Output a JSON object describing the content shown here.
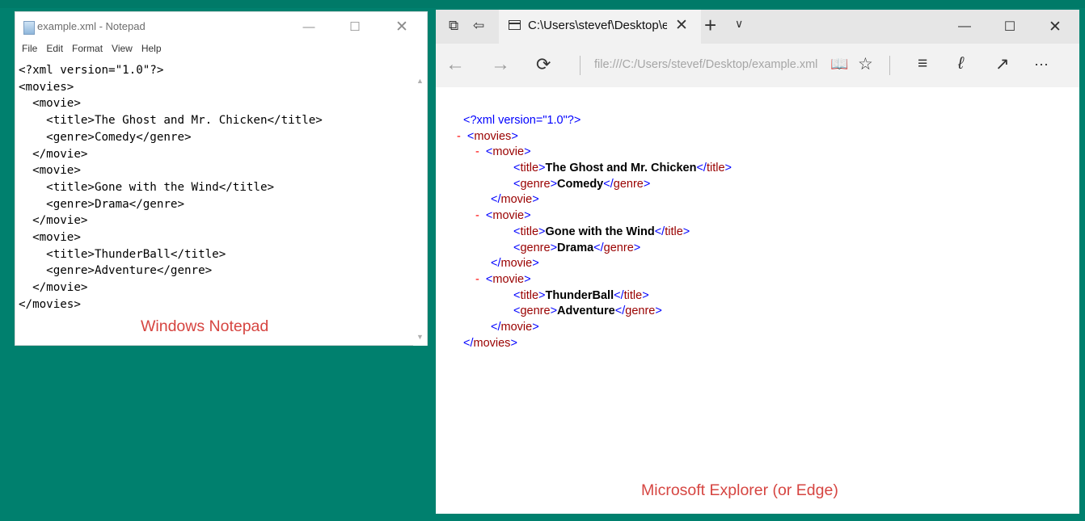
{
  "notepad": {
    "title": "example.xml - Notepad",
    "menu": [
      "File",
      "Edit",
      "Format",
      "View",
      "Help"
    ],
    "content": "<?xml version=\"1.0\"?>\n<movies>\n  <movie>\n    <title>The Ghost and Mr. Chicken</title>\n    <genre>Comedy</genre>\n  </movie>\n  <movie>\n    <title>Gone with the Wind</title>\n    <genre>Drama</genre>\n  </movie>\n  <movie>\n    <title>ThunderBall</title>\n    <genre>Adventure</genre>\n  </movie>\n</movies>",
    "caption": "Windows Notepad"
  },
  "edge": {
    "tab_title": "C:\\Users\\stevef\\Desktop\\example.xml",
    "address": "file:///C:/Users/stevef/Desktop/example.xml",
    "caption": "Microsoft Explorer (or Edge)",
    "xml": {
      "declaration": "<?xml version=\"1.0\"?>",
      "collapse_marker": "-",
      "root_tag": "movies",
      "movies": [
        {
          "title": "The Ghost and Mr. Chicken",
          "genre": "Comedy"
        },
        {
          "title": "Gone with the Wind",
          "genre": "Drama"
        },
        {
          "title": "ThunderBall",
          "genre": "Adventure"
        }
      ]
    }
  },
  "colors": {
    "desktop": "#00806e",
    "caption": "#d64541",
    "xml_markup": "#0000ff",
    "xml_tag_name": "#990000",
    "xml_collapse": "#ff0000"
  }
}
